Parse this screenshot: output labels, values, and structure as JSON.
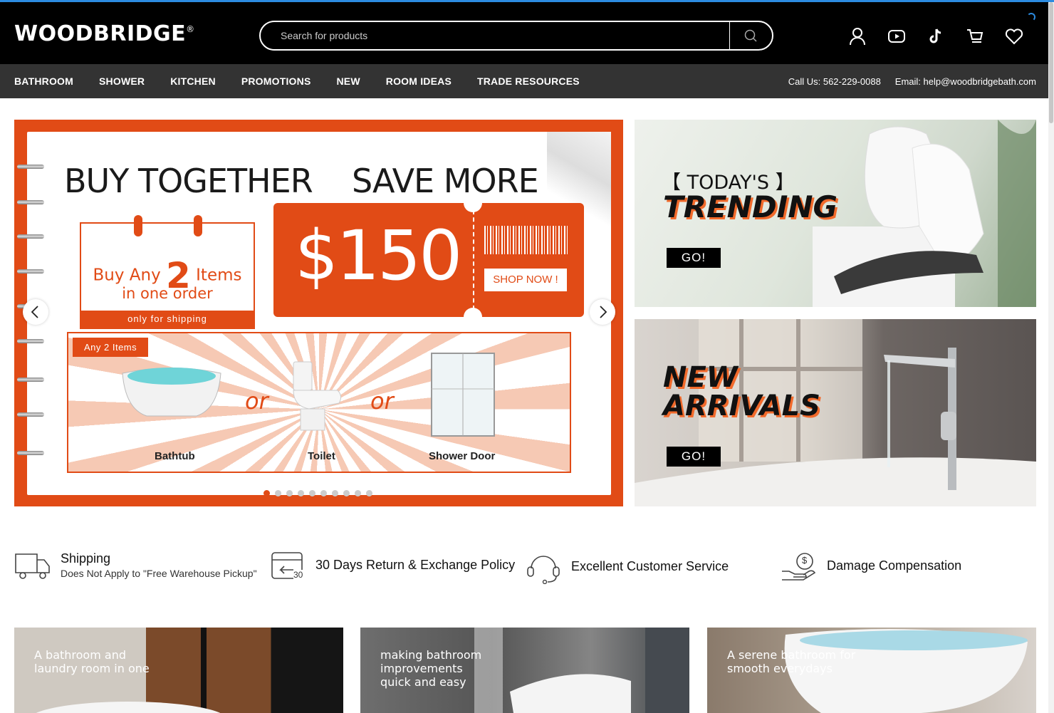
{
  "header": {
    "logo": "WOODBRIDGE",
    "logo_mark": "®",
    "search_placeholder": "Search for products",
    "icons": [
      "account-icon",
      "youtube-icon",
      "tiktok-icon",
      "cart-icon",
      "wishlist-icon"
    ]
  },
  "nav": {
    "items": [
      "BATHROOM",
      "SHOWER",
      "KITCHEN",
      "PROMOTIONS",
      "NEW",
      "ROOM IDEAS",
      "TRADE RESOURCES"
    ],
    "phone": "Call Us: 562-229-0088",
    "email": "Email: help@woodbridgebath.com"
  },
  "slider": {
    "headline_left": "BUY TOGETHER",
    "headline_right": "SAVE MORE",
    "buy_any": "Buy Any",
    "count": "2",
    "items_word": "Items",
    "in_one_order": "in one order",
    "shipping_note": "only for shipping",
    "price": "$150",
    "shop_now": "SHOP NOW !",
    "tag": "Any 2 Items",
    "or": "or",
    "products": [
      "Bathtub",
      "Toilet",
      "Shower Door"
    ],
    "dot_count": 10,
    "active_dot": 0,
    "accent": "#e14b16"
  },
  "promos": {
    "trending_bracket": "【 TODAY'S 】",
    "trending": "TRENDING",
    "new_line1": "NEW",
    "new_line2": "ARRIVALS",
    "go": "GO!"
  },
  "features": [
    {
      "title": "Shipping",
      "subtitle": "Does Not Apply to \"Free Warehouse Pickup\"",
      "icon": "truck-icon"
    },
    {
      "title": "30 Days Return & Exchange Policy",
      "icon": "return-box-icon",
      "badge": "30"
    },
    {
      "title": "Excellent Customer Service",
      "icon": "headset-icon"
    },
    {
      "title": "Damage Compensation",
      "icon": "compensation-hand-icon",
      "badge": "$"
    }
  ],
  "tiles": [
    {
      "caption": "A bathroom and\nlaundry room in one"
    },
    {
      "caption": "making bathroom\nimprovements\nquick and easy"
    },
    {
      "caption": "A serene bathroom for\nsmooth everydays"
    }
  ]
}
